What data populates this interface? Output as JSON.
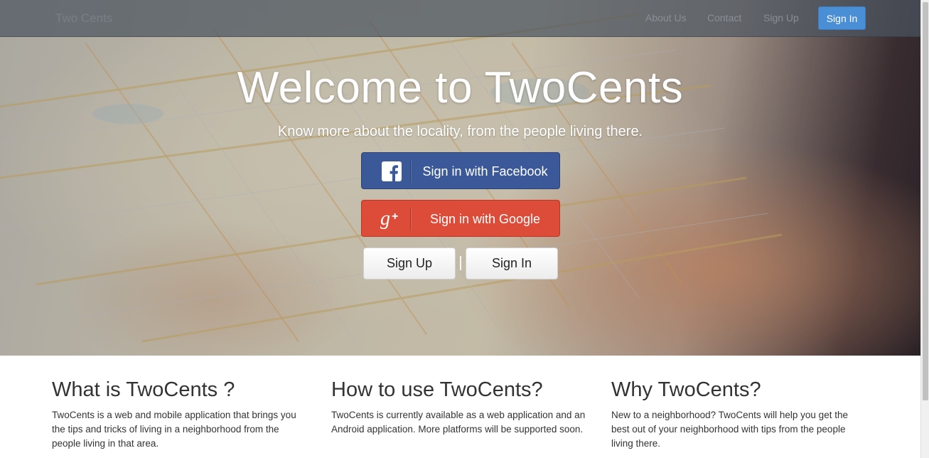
{
  "nav": {
    "brand": "Two Cents",
    "links": [
      "About Us",
      "Contact",
      "Sign Up"
    ],
    "signin_label": "Sign In"
  },
  "hero": {
    "title": "Welcome to TwoCents",
    "subtitle": "Know more about the locality, from the people living there.",
    "facebook_label": "Sign in with Facebook",
    "google_label": "Sign in with Google",
    "signup_label": "Sign Up",
    "signin_label": "Sign In"
  },
  "icons": {
    "facebook": "facebook-icon",
    "google": "google-plus-icon"
  },
  "colors": {
    "facebook": "#3b5998",
    "google": "#dd4b39",
    "nav_signin": "#4a8fd6"
  },
  "info": [
    {
      "title": "What is TwoCents ?",
      "text": "TwoCents is a web and mobile application that brings you the tips and tricks of living in a neighborhood from the people living in that area."
    },
    {
      "title": "How to use TwoCents?",
      "text": "TwoCents is currently available as a web application and an Android application. More platforms will be supported soon."
    },
    {
      "title": "Why TwoCents?",
      "text": "New to a neighborhood? TwoCents will help you get the best out of your neighborhood with tips from the people living there."
    }
  ]
}
